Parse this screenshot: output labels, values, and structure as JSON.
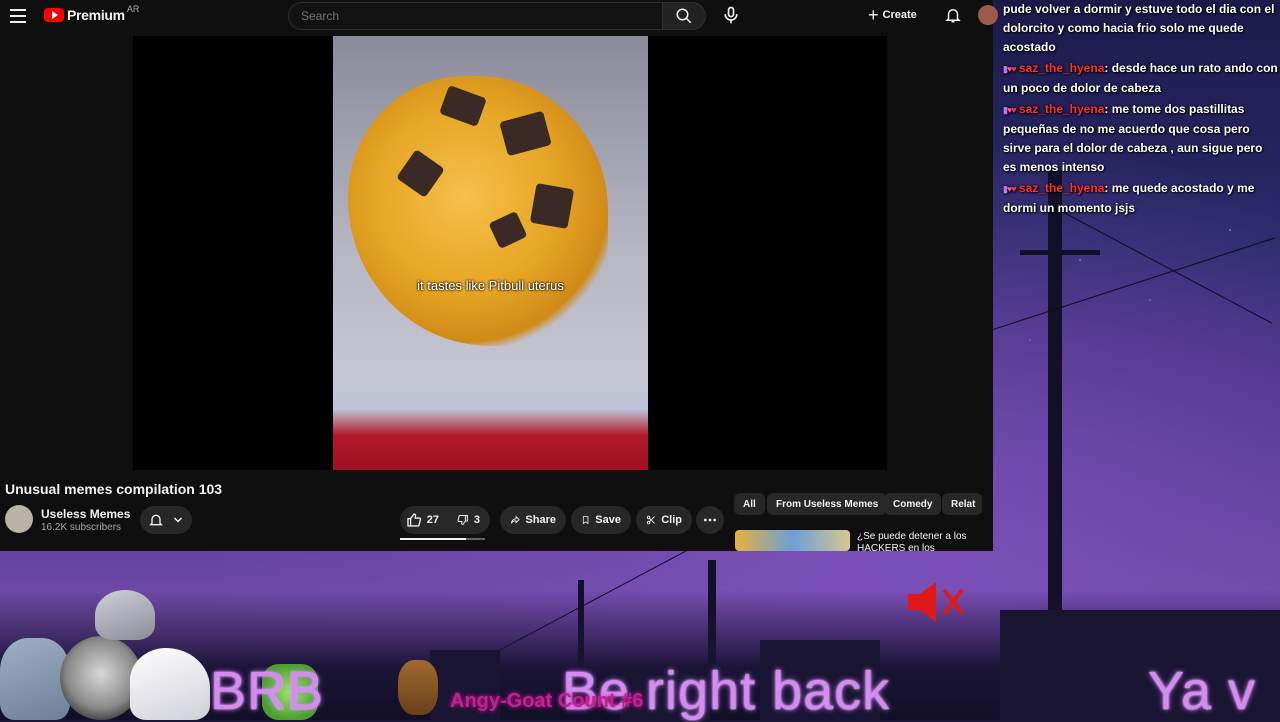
{
  "youtube": {
    "brand": "Premium",
    "region": "AR",
    "search_placeholder": "Search",
    "create_label": "Create",
    "video": {
      "caption": "it tastes like Pitbull uterus",
      "title": "Unusual memes compilation 103"
    },
    "channel": {
      "name": "Useless Memes",
      "subscribers": "16.2K subscribers"
    },
    "actions": {
      "likes": "27",
      "dislikes": "3",
      "share": "Share",
      "save": "Save",
      "clip": "Clip"
    },
    "chips": [
      "All",
      "From Useless Memes",
      "Comedy",
      "Relat"
    ],
    "recommendation": {
      "title": "¿Se puede detener a los HACKERS en los Videojuegos?"
    }
  },
  "chat": [
    {
      "user": "",
      "text": "pude volver a dormir y estuve todo el dia con el dolorcito y como hacia frio solo me quede acostado"
    },
    {
      "user": "saz_the_hyena",
      "text": ": desde hace un rato ando con un poco de dolor de cabeza"
    },
    {
      "user": "saz_the_hyena",
      "text": ": me tome dos pastillitas pequeñas de no me acuerdo que cosa pero sirve para el dolor de cabeza , aun sigue pero es menos intenso"
    },
    {
      "user": "saz_the_hyena",
      "text": ": me quede acostado y me dormi un momento jsjs"
    }
  ],
  "overlay": {
    "brb": "BRB",
    "be_right_back": "Be right back",
    "ya": "Ya v",
    "goat_count": "Angy-Goat Count #6"
  },
  "colors": {
    "yt_bg": "#0f0f0f",
    "yt_red": "#ff0000",
    "chat_username": "#ff3030",
    "overlay_text": "#d58cf0"
  }
}
